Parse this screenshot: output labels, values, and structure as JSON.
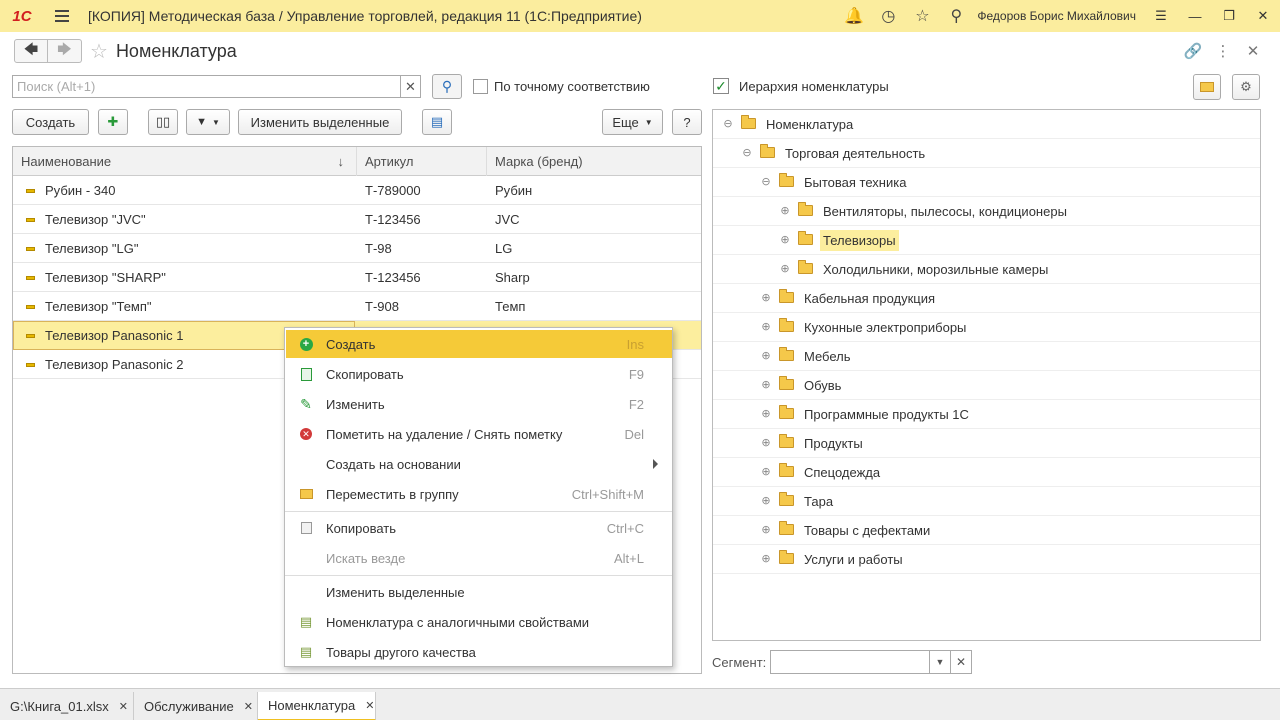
{
  "titlebar": {
    "logo": "1С",
    "title": "[КОПИЯ] Методическая база / Управление торговлей, редакция 11  (1С:Предприятие)",
    "user": "Федоров Борис Михайлович",
    "icons": [
      "bell-icon",
      "history-icon",
      "star-icon",
      "search-icon"
    ]
  },
  "form": {
    "title": "Номенклатура"
  },
  "search": {
    "placeholder": "Поиск (Alt+1)",
    "exact_label": "По точному соответствию"
  },
  "toolbar": {
    "create_label": "Создать",
    "change_selected_label": "Изменить выделенные",
    "more_label": "Еще",
    "help_label": "?"
  },
  "table": {
    "columns": [
      "Наименование",
      "Артикул",
      "Марка (бренд)"
    ],
    "rows": [
      {
        "name": "Рубин - 340",
        "article": "Т-789000",
        "brand": "Рубин"
      },
      {
        "name": "Телевизор \"JVC\"",
        "article": "Т-123456",
        "brand": "JVC"
      },
      {
        "name": "Телевизор \"LG\"",
        "article": "Т-98",
        "brand": "LG"
      },
      {
        "name": "Телевизор \"SHARP\"",
        "article": "Т-123456",
        "brand": "Sharp"
      },
      {
        "name": "Телевизор \"Темп\"",
        "article": "Т-908",
        "brand": "Темп"
      },
      {
        "name": "Телевизор Panasonic 1",
        "article": "",
        "brand": ""
      },
      {
        "name": "Телевизор Panasonic 2",
        "article": "",
        "brand": ""
      }
    ]
  },
  "context_menu": {
    "items": [
      {
        "label": "Создать",
        "shortcut": "Ins"
      },
      {
        "label": "Скопировать",
        "shortcut": "F9"
      },
      {
        "label": "Изменить",
        "shortcut": "F2"
      },
      {
        "label": "Пометить на удаление / Снять пометку",
        "shortcut": "Del"
      },
      {
        "label": "Создать на основании",
        "shortcut": ""
      },
      {
        "label": "Переместить в группу",
        "shortcut": "Ctrl+Shift+M"
      },
      {
        "label": "Копировать",
        "shortcut": "Ctrl+C"
      },
      {
        "label": "Искать везде",
        "shortcut": "Alt+L"
      },
      {
        "label": "Изменить выделенные",
        "shortcut": ""
      },
      {
        "label": "Номенклатура с аналогичными свойствами",
        "shortcut": ""
      },
      {
        "label": "Товары другого качества",
        "shortcut": ""
      }
    ]
  },
  "hierarchy": {
    "label": "Иерархия номенклатуры",
    "nodes": [
      "Номенклатура",
      "Торговая деятельность",
      "Бытовая техника",
      "Вентиляторы, пылесосы, кондиционеры",
      "Телевизоры",
      "Холодильники, морозильные камеры",
      "Кабельная продукция",
      "Кухонные электроприборы",
      "Мебель",
      "Обувь",
      "Программные продукты 1С",
      "Продукты",
      "Спецодежда",
      "Тара",
      "Товары с дефектами",
      "Услуги и работы"
    ]
  },
  "segment": {
    "label": "Сегмент:"
  },
  "tabs": [
    {
      "label": "G:\\Книга_01.xlsx"
    },
    {
      "label": "Обслуживание"
    },
    {
      "label": "Номенклатура"
    }
  ]
}
